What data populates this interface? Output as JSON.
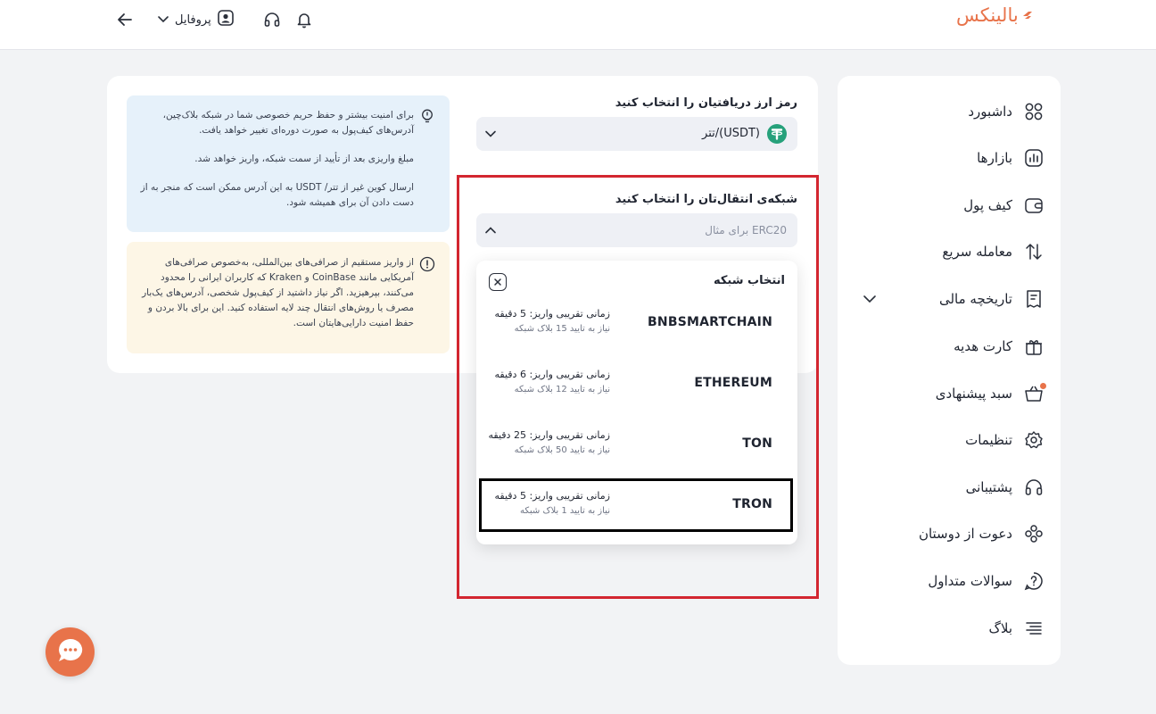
{
  "header": {
    "logo_text": "بالینکس",
    "profile_label": "پروفایل"
  },
  "sidebar": {
    "items": [
      {
        "label": "داشبورد",
        "icon": "dashboard-icon"
      },
      {
        "label": "بازارها",
        "icon": "markets-icon"
      },
      {
        "label": "کیف پول",
        "icon": "wallet-icon"
      },
      {
        "label": "معامله سریع",
        "icon": "swap-icon"
      },
      {
        "label": "تاریخچه مالی",
        "icon": "receipt-icon"
      },
      {
        "label": "کارت هدیه",
        "icon": "gift-icon"
      },
      {
        "label": "سبد پیشنهادی",
        "icon": "basket-icon"
      },
      {
        "label": "تنظیمات",
        "icon": "gear-icon"
      },
      {
        "label": "پشتیبانی",
        "icon": "headset-icon"
      },
      {
        "label": "دعوت از دوستان",
        "icon": "users-icon"
      },
      {
        "label": "سوالات متداول",
        "icon": "faq-icon"
      },
      {
        "label": "بلاگ",
        "icon": "blog-icon"
      }
    ]
  },
  "form": {
    "currency_label": "رمز ارز دریافتیان را انتخاب کنید",
    "currency_value": "تتر/(USDT)",
    "network_label": "شبکه‌ی انتقال‌تان را انتخاب کنید",
    "network_placeholder": "برای مثال ERC20"
  },
  "info": {
    "line1": "برای امنیت بیشتر و حفظ حریم خصوصی شما در شبکه بلاک‌چین، آدرس‌های کیف‌پول به صورت دوره‌ای تغییر خواهد یافت.",
    "line2": "مبلغ واریزی بعد از تأیید از سمت شبکه، واریز خواهد شد.",
    "line3": "ارسال کوین غیر از تتر/ USDT به این آدرس ممکن است که منجر به از دست دادن آن برای همیشه شود."
  },
  "warning": {
    "text": "از واریز مستقیم از صرافی‌های بین‌المللی، به‌خصوص صرافی‌های آمریکایی مانند CoinBase و Kraken که کاربران ایرانی را محدود می‌کنند، بپرهیزید. اگر نیاز داشتید از کیف‌پول شخصی، آدرس‌های یک‌بار مصرف یا روش‌های انتقال چند لایه استفاده کنید. این برای بالا بردن و حفظ امنیت دارایی‌هایتان است."
  },
  "dropdown": {
    "title": "انتخاب شبکه",
    "networks": [
      {
        "name": "BNBSMARTCHAIN",
        "time": "زمانی تقریبی واریز: 5 دقیقه",
        "confirm": "نیاز به تایید 15 بلاک شبکه"
      },
      {
        "name": "ETHEREUM",
        "time": "زمانی تقریبی واریز: 6 دقیقه",
        "confirm": "نیاز به تایید 12 بلاک شبکه"
      },
      {
        "name": "TON",
        "time": "زمانی تقریبی واریز: 25 دقیقه",
        "confirm": "نیاز به تایید 50 بلاک شبکه"
      },
      {
        "name": "TRON",
        "time": "زمانی تقریبی واریز: 5 دقیقه",
        "confirm": "نیاز به تایید 1 بلاک شبکه"
      }
    ]
  },
  "colors": {
    "brand": "#e8734a",
    "tether": "#26a17b",
    "highlight_red": "#d32630"
  }
}
